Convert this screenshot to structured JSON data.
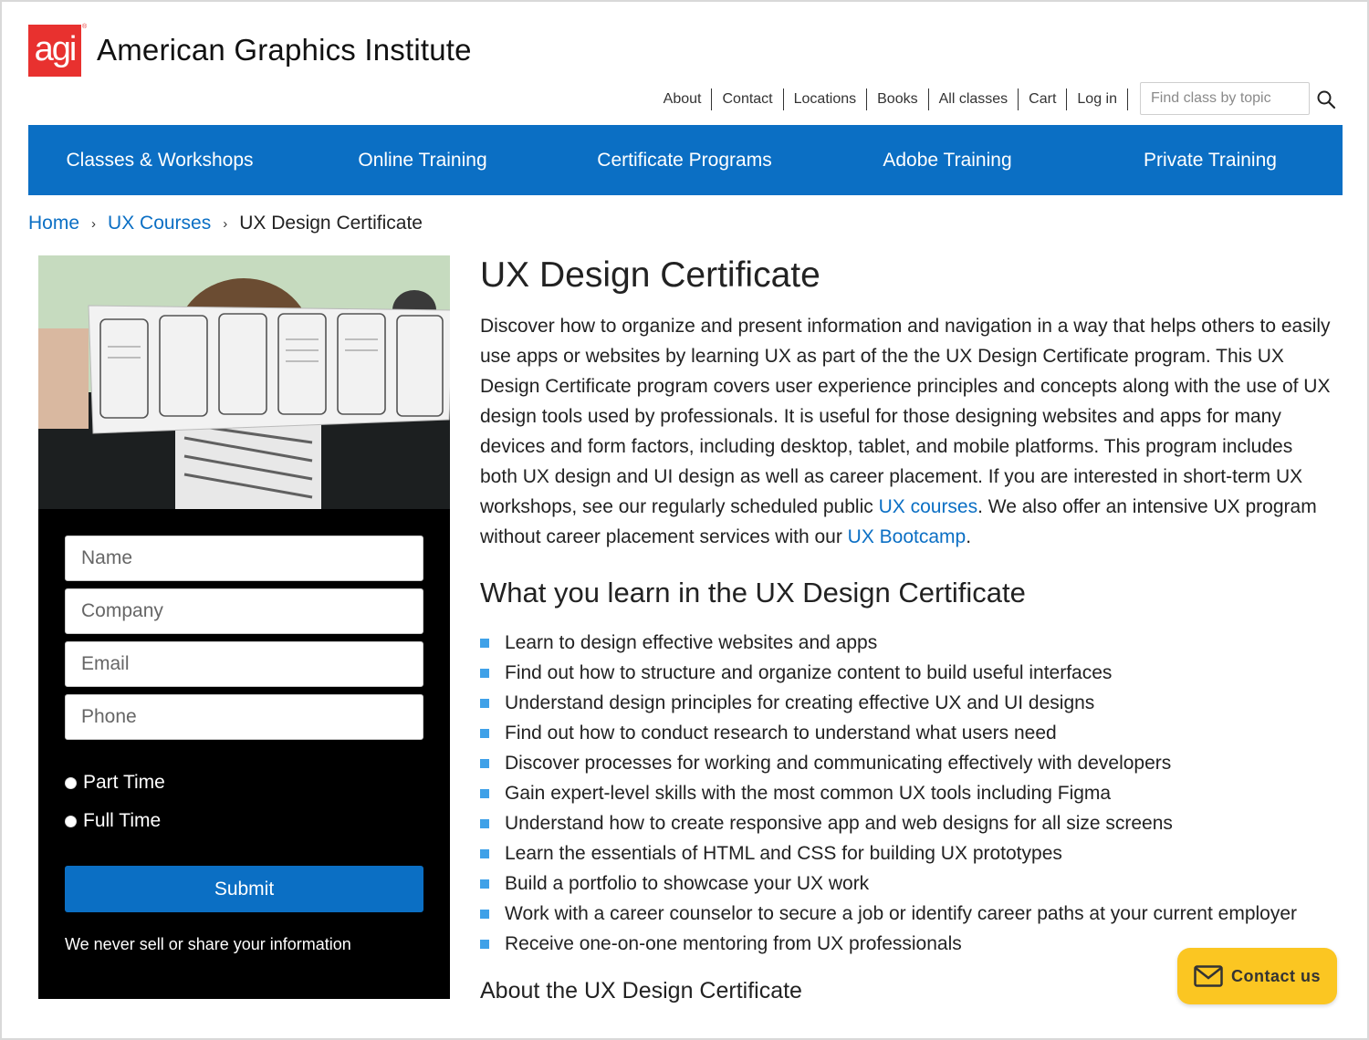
{
  "colors": {
    "brand_blue": "#0b6fc4",
    "logo_red": "#e8312f",
    "bullet_blue": "#3fa1e8",
    "contact_yellow": "#fbc622"
  },
  "header": {
    "logo_text": "agi",
    "logo_reg": "®",
    "site_title": "American Graphics Institute",
    "utility_nav": [
      "About",
      "Contact",
      "Locations",
      "Books",
      "All classes",
      "Cart",
      "Log in"
    ],
    "search": {
      "placeholder": "Find class by topic",
      "icon": "search-icon"
    }
  },
  "main_nav": [
    "Classes & Workshops",
    "Online Training",
    "Certificate Programs",
    "Adobe Training",
    "Private Training"
  ],
  "breadcrumb": {
    "home": "Home",
    "parent": "UX Courses",
    "current": "UX Design Certificate",
    "separator": "›"
  },
  "form": {
    "name_placeholder": "Name",
    "company_placeholder": "Company",
    "email_placeholder": "Email",
    "phone_placeholder": "Phone",
    "options": [
      "Part Time",
      "Full Time"
    ],
    "submit_label": "Submit",
    "privacy_note": "We never sell or share your information"
  },
  "content": {
    "title": "UX Design Certificate",
    "intro_text": "Discover how to organize and present information and navigation in a way that helps others to easily use apps or websites by learning UX as part of the the UX Design Certificate program. This UX Design Certificate program covers user experience principles and concepts along with the use of UX design tools used by professionals. It is useful for those designing websites and apps for many devices and form factors, including desktop, tablet, and mobile platforms. This program includes both UX design and UI design as well as career placement. If you are interested in short-term UX workshops, see our regularly scheduled public ",
    "intro_link1": "UX courses",
    "intro_mid": ". We also offer an intensive UX program without career placement services with our ",
    "intro_link2": "UX Bootcamp",
    "intro_end": ".",
    "learn_heading": "What you learn in the UX Design Certificate",
    "learn_items": [
      "Learn to design effective websites and apps",
      "Find out how to structure and organize content to build useful interfaces",
      "Understand design principles for creating effective UX and UI designs",
      "Find out how to conduct research to understand what users need",
      "Discover processes for working and communicating effectively with developers",
      "Gain expert-level skills with the most common UX tools including Figma",
      "Understand how to create responsive app and web designs for all size screens",
      "Learn the essentials of HTML and CSS for building UX prototypes",
      "Build a portfolio to showcase your UX work",
      "Work with a career counselor to secure a job or identify career paths at your current employer",
      "Receive one-on-one mentoring from UX professionals"
    ],
    "about_heading": "About the UX Design Certificate"
  },
  "contact_widget": {
    "label": "Contact us",
    "icon": "mail-icon"
  }
}
